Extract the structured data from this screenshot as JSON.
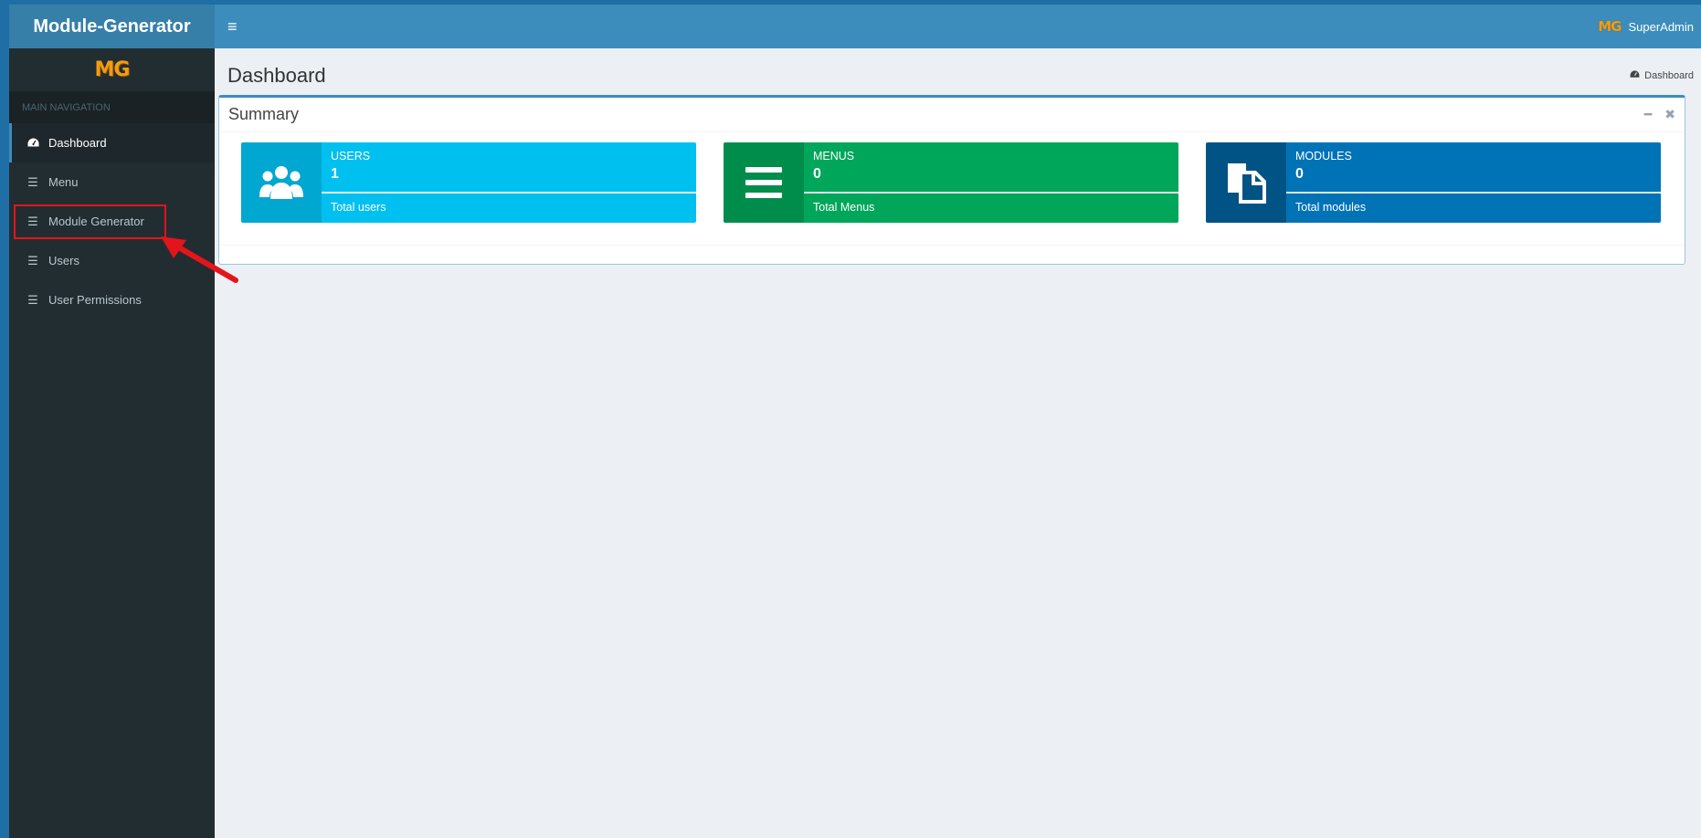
{
  "header": {
    "app_title": "Module-Generator",
    "user_logo": "MG",
    "user_name": "SuperAdmin",
    "toggle_icon": "hamburger-icon"
  },
  "sidebar": {
    "brand_logo": "MG",
    "nav_header": "MAIN NAVIGATION",
    "items": [
      {
        "label": "Dashboard",
        "icon": "dashboard-icon",
        "active": true
      },
      {
        "label": "Menu",
        "icon": "list-icon"
      },
      {
        "label": "Module Generator",
        "icon": "list-icon",
        "highlighted": true
      },
      {
        "label": "Users",
        "icon": "list-icon"
      },
      {
        "label": "User Permissions",
        "icon": "list-icon"
      }
    ]
  },
  "content": {
    "page_title": "Dashboard",
    "breadcrumb": "Dashboard"
  },
  "summary": {
    "title": "Summary",
    "cards": [
      {
        "label": "USERS",
        "value": "1",
        "desc": "Total users",
        "icon": "users-icon",
        "color": "#00c0ef"
      },
      {
        "label": "MENUS",
        "value": "0",
        "desc": "Total Menus",
        "icon": "menu-lines-icon",
        "color": "#00a65a"
      },
      {
        "label": "MODULES",
        "value": "0",
        "desc": "Total modules",
        "icon": "files-icon",
        "color": "#0073b7"
      }
    ]
  },
  "colors": {
    "accent": "#3c8dbc",
    "sidebar_bg": "#222d32",
    "annotation": "#e4141b"
  }
}
